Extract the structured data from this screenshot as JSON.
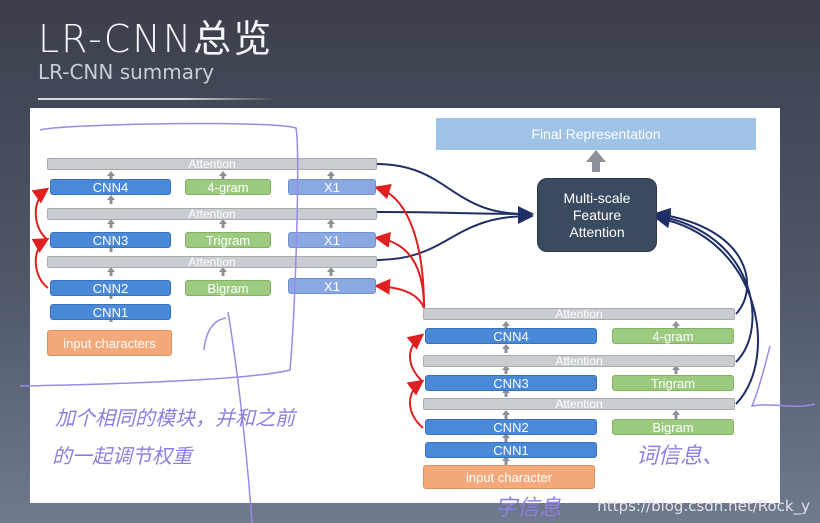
{
  "slide": {
    "title": "LR-CNN总览",
    "subtitle": "LR-CNN summary"
  },
  "diagram": {
    "top_output": "Final Representation",
    "fusion": "Multi-scale\nFeature\nAttention",
    "fusion_lines": [
      "Multi-scale",
      "Feature",
      "Attention"
    ],
    "left_module": {
      "attention_labels": [
        "Attention",
        "Attention",
        "Attention"
      ],
      "cnn": [
        "CNN4",
        "CNN3",
        "CNN2",
        "CNN1"
      ],
      "ngrams": [
        "4-gram",
        "Trigram",
        "Bigram"
      ],
      "x": [
        "X1",
        "X1",
        "X1"
      ],
      "input": "input characters"
    },
    "right_module": {
      "attention_labels": [
        "Attention",
        "Attention",
        "Attention"
      ],
      "cnn": [
        "CNN4",
        "CNN3",
        "CNN2",
        "CNN1"
      ],
      "ngrams": [
        "4-gram",
        "Trigram",
        "Bigram"
      ],
      "input": "input character"
    }
  },
  "annotations": {
    "line1": "加个相同的模块，并和之前",
    "line2": "的一起调节权重",
    "word_info": "词信息、",
    "char_info": "字信息"
  },
  "watermark": "https://blog.csdn.net/Rock_y"
}
